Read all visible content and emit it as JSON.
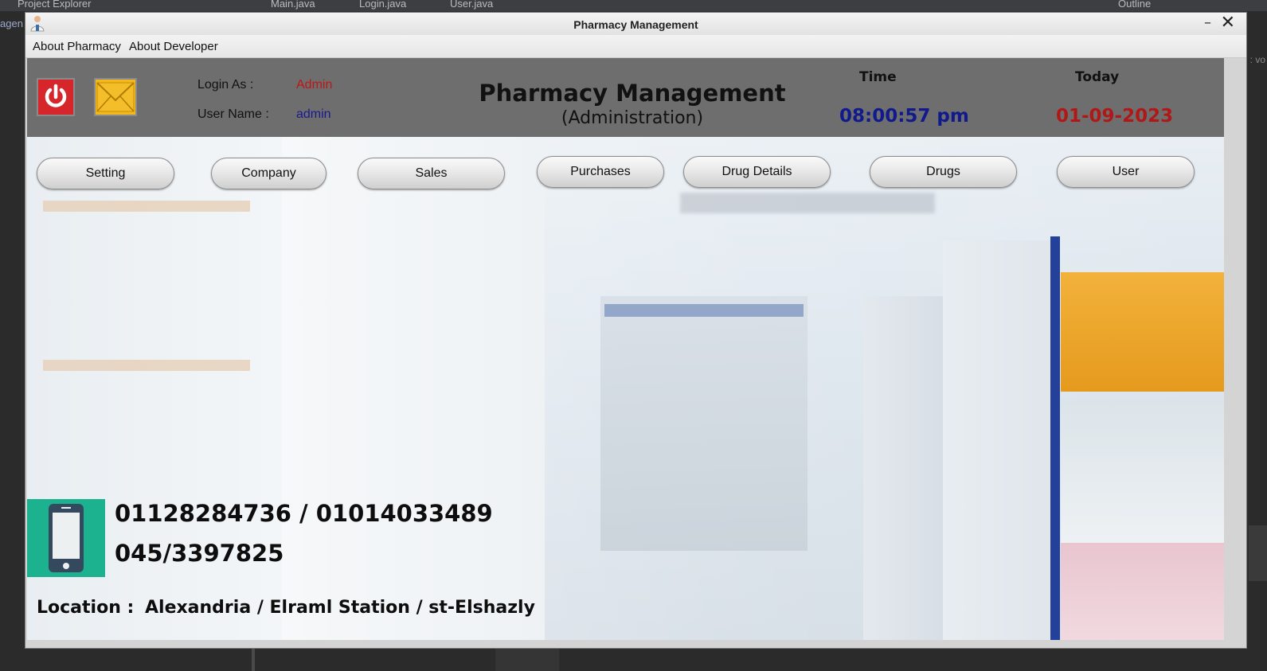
{
  "ide": {
    "tabs": [
      "Project Explorer",
      "Main.java",
      "Login.java",
      "User.java",
      "Outline"
    ],
    "left_text": "agen",
    "right_text": ": vo"
  },
  "window": {
    "title": "Pharmacy Management",
    "min_label": "–",
    "close_label": "✕"
  },
  "menu": {
    "items": [
      "About Pharmacy",
      "About Developer"
    ]
  },
  "header": {
    "login_as_label": "Login As :",
    "login_as_value": "Admin",
    "user_name_label": "User Name :",
    "user_name_value": "admin",
    "title": "Pharmacy Management",
    "subtitle": "(Administration)",
    "time_label": "Time",
    "time_value": "08:00:57 pm",
    "today_label": "Today",
    "date_value": "01-09-2023"
  },
  "nav": {
    "buttons": [
      "Setting",
      "Company",
      "Sales",
      "Purchases",
      "Drug Details",
      "Drugs",
      "User"
    ]
  },
  "contact": {
    "phone_line_1": "01128284736 / 01014033489",
    "phone_line_2": "045/3397825",
    "location_label": "Location :",
    "location_value": "Alexandria / Elraml Station / st-Elshazly"
  },
  "colors": {
    "header_bg": "#6e6e6e",
    "admin_red": "#c01515",
    "admin_blue": "#1a1a8c",
    "time_blue": "#111a8c",
    "date_red": "#b01818",
    "phone_icon_bg": "#1db28f"
  }
}
